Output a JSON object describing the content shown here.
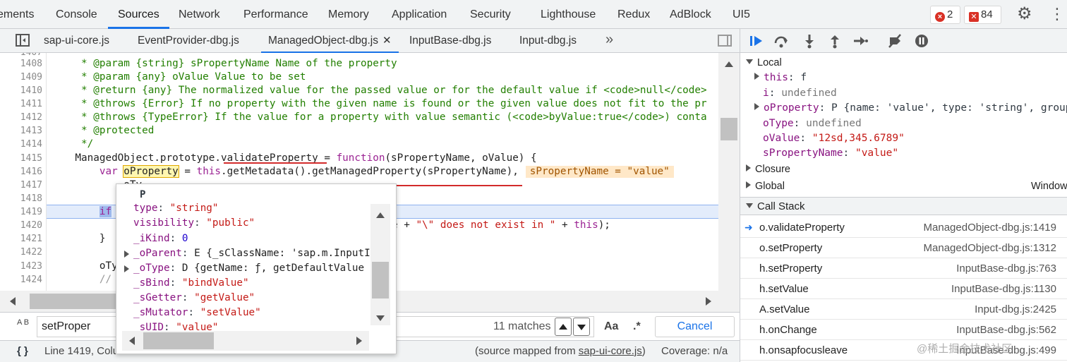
{
  "main_tabs": [
    {
      "label": "ements"
    },
    {
      "label": "Console"
    },
    {
      "label": "Sources"
    },
    {
      "label": "Network"
    },
    {
      "label": "Performance"
    },
    {
      "label": "Memory"
    },
    {
      "label": "Application"
    },
    {
      "label": "Security"
    },
    {
      "label": "Lighthouse"
    },
    {
      "label": "Redux"
    },
    {
      "label": "AdBlock"
    },
    {
      "label": "UI5"
    }
  ],
  "badges": {
    "errors": "2",
    "issues": "84",
    "error_glyph": "×",
    "issue_glyph": "✕"
  },
  "icons": {
    "gear": "⚙",
    "more": "⋮",
    "chevrons": "»",
    "close": "✕"
  },
  "file_tabs": [
    {
      "label": "sap-ui-core.js"
    },
    {
      "label": "EventProvider-dbg.js"
    },
    {
      "label": "ManagedObject-dbg.js"
    },
    {
      "label": "InputBase-dbg.js"
    },
    {
      "label": "Input-dbg.js"
    }
  ],
  "editor": {
    "line_numbers": [
      "1407",
      "1408",
      "1409",
      "1410",
      "1411",
      "1412",
      "1413",
      "1414",
      "1415",
      "1416",
      "1417",
      "1418",
      "1419",
      "1420",
      "1421",
      "1422",
      "1423",
      "1424"
    ],
    "lines": {
      "l1408": "     * @param {string} sPropertyName Name of the property",
      "l1409": "     * @param {any} oValue Value to be set",
      "l1410": "     * @return {any} The normalized value for the passed value or for the default value if <code>null</code>",
      "l1411": "     * @throws {Error} If no property with the given name is found or the given value does not fit to the pr",
      "l1412": "     * @throws {TypeError} If the value for a property with value semantic (<code>byValue:true</code>) conta",
      "l1413": "     * @protected",
      "l1414": "     */",
      "l1415_a": "    ManagedObject.prototype.validateProperty = ",
      "l1415_kw": "function",
      "l1415_b": "(sPropertyName, oValue) {",
      "l1416_kw": "        var ",
      "l1416_var": "oProperty",
      "l1416_b": " = ",
      "l1416_this": "this",
      "l1416_c": ".getMetadata().getManagedProperty(sPropertyName),",
      "l1416_inline": "sPropertyName = \"value\"",
      "l1417": "            oTy",
      "l1419_kw": "if",
      "l1420_a": "e + ",
      "l1420_str": "\"\\\" does not exist in \"",
      "l1420_b": " + ",
      "l1420_this": "this",
      "l1420_c": ");",
      "l1421": "        }",
      "l1423": "        oTy",
      "l1424": "        //"
    }
  },
  "popover": {
    "title": "P",
    "rows": [
      {
        "key": "type",
        "val": "\"string\"",
        "kind": "str",
        "expandable": false
      },
      {
        "key": "visibility",
        "val": "\"public\"",
        "kind": "str",
        "expandable": false
      },
      {
        "key": "_iKind",
        "val": "0",
        "kind": "num",
        "expandable": false
      },
      {
        "key": "_oParent",
        "val": "E {_sClassName: 'sap.m.InputI",
        "kind": "obj",
        "expandable": true
      },
      {
        "key": "_oType",
        "val": "D {getName: ƒ, getDefaultValue",
        "kind": "obj",
        "expandable": true
      },
      {
        "key": "_sBind",
        "val": "\"bindValue\"",
        "kind": "str",
        "expandable": false
      },
      {
        "key": "_sGetter",
        "val": "\"getValue\"",
        "kind": "str",
        "expandable": false
      },
      {
        "key": "_sMutator",
        "val": "\"setValue\"",
        "kind": "str",
        "expandable": false
      },
      {
        "key": "_sUID",
        "val": "\"value\"",
        "kind": "str",
        "expandable": false
      }
    ]
  },
  "search": {
    "value": "setProper",
    "matches": "11 matches",
    "case_label": "Aa",
    "regex_label": ".*",
    "cancel_label": "Cancel",
    "icon_label": "A B"
  },
  "status": {
    "position": "Line 1419, Colu",
    "source_mapped_prefix": "(source mapped from ",
    "source_file": "sap-ui-core.js",
    "source_mapped_suffix": ")",
    "coverage": "Coverage: n/a",
    "braces": "{ }"
  },
  "scope": {
    "local_label": "Local",
    "vars": [
      {
        "key": "this",
        "val": "f",
        "expandable": true
      },
      {
        "key": "i",
        "val": "undefined",
        "expandable": false
      },
      {
        "key": "oProperty",
        "val": "P {name: 'value', type: 'string', group",
        "expandable": true
      },
      {
        "key": "oType",
        "val": "undefined",
        "expandable": false
      },
      {
        "key": "oValue",
        "val": "\"12sd,345.6789\"",
        "expandable": false
      },
      {
        "key": "sPropertyName",
        "val": "\"value\"",
        "expandable": false
      }
    ],
    "closure_label": "Closure",
    "global_label": "Global",
    "global_value": "Window"
  },
  "call_stack": {
    "label": "Call Stack",
    "frames": [
      {
        "fn": "o.validateProperty",
        "loc": "ManagedObject-dbg.js:1419"
      },
      {
        "fn": "o.setProperty",
        "loc": "ManagedObject-dbg.js:1312"
      },
      {
        "fn": "h.setProperty",
        "loc": "InputBase-dbg.js:763"
      },
      {
        "fn": "h.setValue",
        "loc": "InputBase-dbg.js:1130"
      },
      {
        "fn": "A.setValue",
        "loc": "Input-dbg.js:2425"
      },
      {
        "fn": "h.onChange",
        "loc": "InputBase-dbg.js:562"
      },
      {
        "fn": "h.onsapfocusleave",
        "loc": "InputBase-dbg.js:499"
      }
    ]
  },
  "watermark": "@稀土掘金技术社区"
}
